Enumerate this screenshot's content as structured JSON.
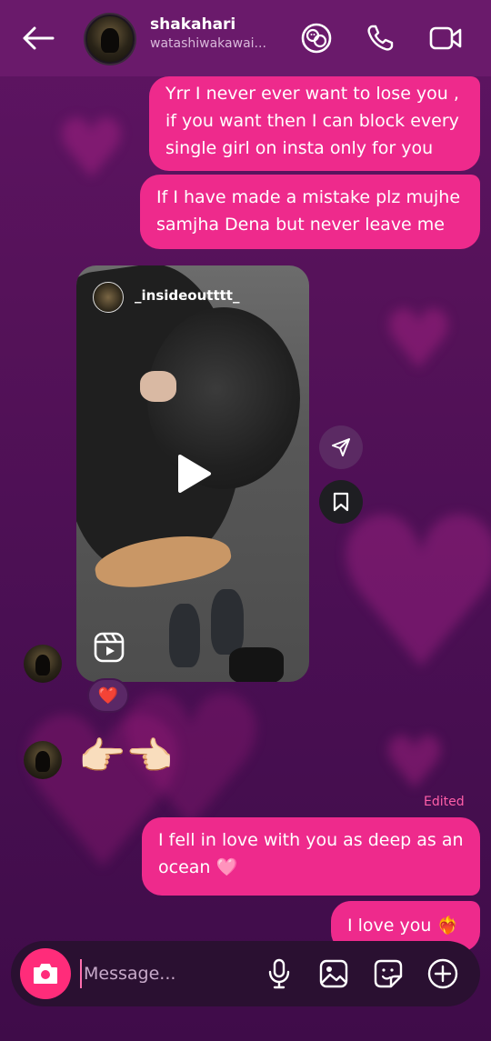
{
  "header": {
    "name": "shakahari",
    "username": "watashiwakawai..."
  },
  "messages": {
    "msg1_line1": "Yrr I never ever want to lose you ,",
    "msg1_line2": "if you want then I can block every",
    "msg1_line3": "single girl on insta only for you",
    "msg2_line1": "If I have made a mistake plz mujhe",
    "msg2_line2": "samjha Dena but never leave me",
    "reel_username": "_insideoutttt_",
    "reaction": "❤️",
    "emoji_msg": "👉🏻👈🏻",
    "edited_label": "Edited",
    "msg3_line1": "I fell in love with you as deep as an",
    "msg3_line2": "ocean 🩷",
    "msg4": "I love you ❤️‍🔥"
  },
  "composer": {
    "placeholder": "Message..."
  },
  "colors": {
    "bubble": "#ee2a8c",
    "header": "#6a1a6b",
    "camera": "#ff2c7a",
    "edited": "#ff5fa8"
  }
}
